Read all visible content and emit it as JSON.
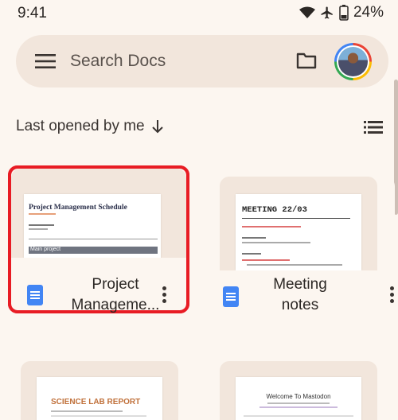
{
  "status_bar": {
    "time": "9:41",
    "battery": "24%"
  },
  "search": {
    "placeholder": "Search Docs"
  },
  "sort": {
    "label": "Last opened by me"
  },
  "docs": [
    {
      "title_line1": "Project",
      "title_line2": "Manageme...",
      "thumb_heading": "Project Management Schedule",
      "thumb_row": "Main project",
      "selected": true
    },
    {
      "title_line1": "Meeting",
      "title_line2": "notes",
      "thumb_heading": "MEETING 22/03"
    },
    {
      "thumb_heading": "SCIENCE LAB REPORT"
    },
    {
      "thumb_heading": "Welcome To Mastodon"
    }
  ],
  "colors": {
    "background": "#fcf6f0",
    "surface": "#f2e6dc",
    "doc_icon": "#4285f4",
    "selection": "#e81c24"
  }
}
